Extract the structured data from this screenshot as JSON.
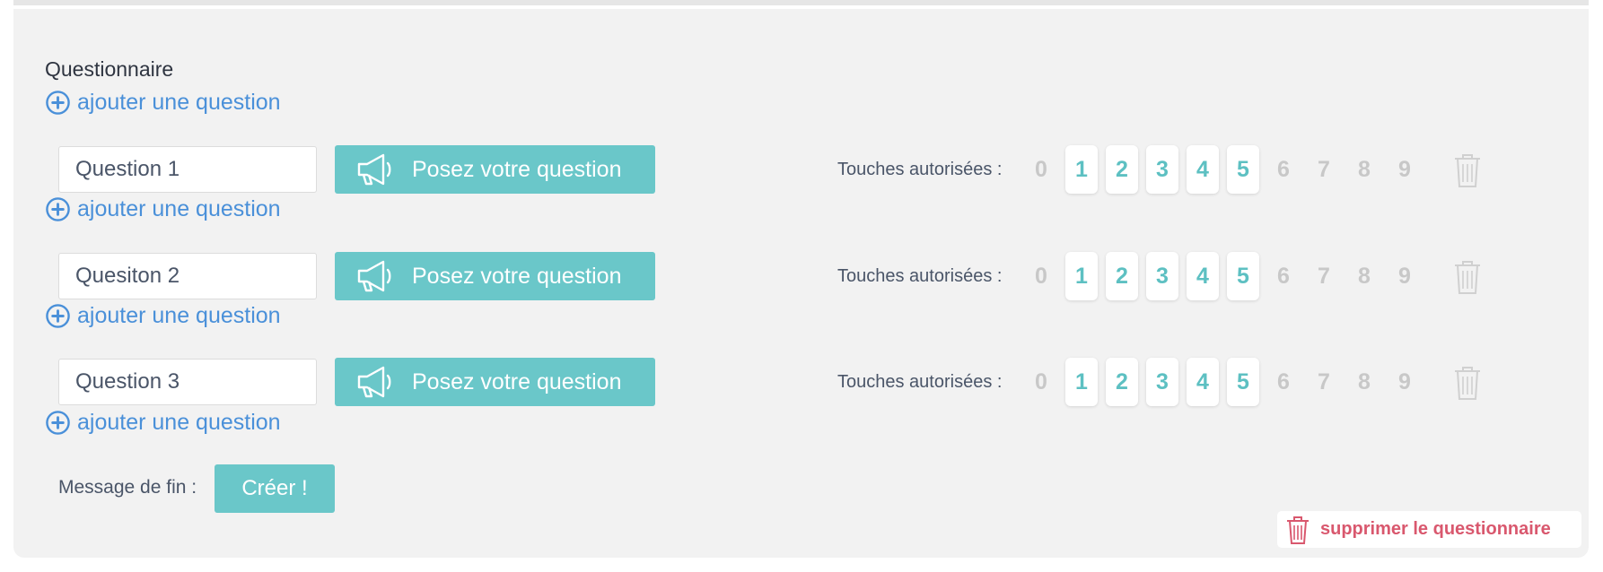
{
  "section_title": "Questionnaire",
  "add_question_label": "ajouter une question",
  "ask_button_label": "Posez votre question",
  "keys_label": "Touches autorisées :",
  "questions": [
    {
      "value": "Question 1"
    },
    {
      "value": "Quesiton 2"
    },
    {
      "value": "Question 3"
    }
  ],
  "keys": [
    "0",
    "1",
    "2",
    "3",
    "4",
    "5",
    "6",
    "7",
    "8",
    "9"
  ],
  "enabled_keys": [
    "1",
    "2",
    "3",
    "4",
    "5"
  ],
  "end_message_label": "Message de fin :",
  "create_button_label": "Créer !",
  "delete_questionnaire_label": "supprimer le questionnaire",
  "colors": {
    "accent": "#6ac7c9",
    "link": "#4a90d9",
    "danger": "#d9586e",
    "disabled": "#c8c8c8"
  },
  "icons": {
    "add": "plus-circle-icon",
    "ask": "megaphone-icon",
    "delete": "trash-icon"
  }
}
